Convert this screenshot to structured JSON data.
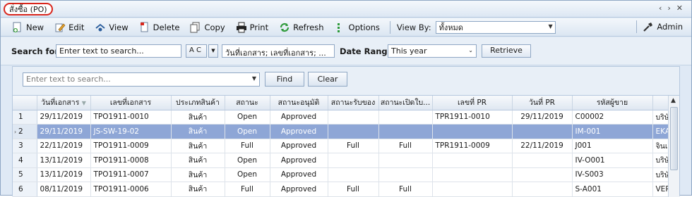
{
  "window": {
    "tab_title": "สั่งซื้อ (PO)",
    "ctrl_prev": "‹",
    "ctrl_next": "›",
    "ctrl_close": "✕"
  },
  "toolbar": {
    "buttons": [
      {
        "label": "New",
        "icon": "new-document-icon",
        "glyph": "📄"
      },
      {
        "label": "Edit",
        "icon": "edit-pencil-icon",
        "glyph": "✎"
      },
      {
        "label": "View",
        "icon": "view-icon",
        "glyph": "⌂"
      },
      {
        "label": "Delete",
        "icon": "delete-icon",
        "glyph": "▮"
      },
      {
        "label": "Copy",
        "icon": "copy-icon",
        "glyph": "❐"
      },
      {
        "label": "Print",
        "icon": "printer-icon",
        "glyph": "⎙"
      },
      {
        "label": "Refresh",
        "icon": "refresh-icon",
        "glyph": "↻"
      },
      {
        "label": "Options",
        "icon": "options-icon",
        "glyph": "⋮"
      }
    ],
    "viewby_label": "View By:",
    "viewby_value": "ทั้งหมด",
    "admin_label": "Admin"
  },
  "search": {
    "label": "Search for",
    "input_value": "Enter text to search...",
    "case_button": "A C",
    "fields_value": "วันที่เอกสาร; เลขที่เอกสาร; ...",
    "date_range_label": "Date Range",
    "date_range_value": "This year",
    "retrieve_label": "Retrieve"
  },
  "filter": {
    "placeholder": "Enter text to search...",
    "find_label": "Find",
    "clear_label": "Clear"
  },
  "grid": {
    "columns": [
      "วันที่เอกสาร",
      "เลขที่เอกสาร",
      "ประเภทสินค้า",
      "สถานะ",
      "สถานะอนุมัติ",
      "สถานะรับของ",
      "สถานะเปิดใบ...",
      "เลขที่ PR",
      "วันที่ PR",
      "รหัสผู้ขาย",
      ""
    ],
    "rows": [
      {
        "n": "1",
        "date": "29/11/2019",
        "doc": "TPO1911-0010",
        "type": "สินค้า",
        "status": "Open",
        "approve": "Approved",
        "receive": "",
        "invoice": "",
        "pr": "TPR1911-0010",
        "prdate": "29/11/2019",
        "vendor": "C00002",
        "extra": "บริษั",
        "selected": false
      },
      {
        "n": "2",
        "date": "29/11/2019",
        "doc": "JS-SW-19-02",
        "type": "สินค้า",
        "status": "Open",
        "approve": "Approved",
        "receive": "",
        "invoice": "",
        "pr": "",
        "prdate": "",
        "vendor": "IM-001",
        "extra": "EKAI",
        "selected": true
      },
      {
        "n": "3",
        "date": "22/11/2019",
        "doc": "TPO1911-0009",
        "type": "สินค้า",
        "status": "Full",
        "approve": "Approved",
        "receive": "Full",
        "invoice": "Full",
        "pr": "TPR1911-0009",
        "prdate": "22/11/2019",
        "vendor": "J001",
        "extra": "จินเ",
        "selected": false
      },
      {
        "n": "4",
        "date": "13/11/2019",
        "doc": "TPO1911-0008",
        "type": "สินค้า",
        "status": "Open",
        "approve": "Approved",
        "receive": "",
        "invoice": "",
        "pr": "",
        "prdate": "",
        "vendor": "IV-O001",
        "extra": "บริษั",
        "selected": false
      },
      {
        "n": "5",
        "date": "13/11/2019",
        "doc": "TPO1911-0007",
        "type": "สินค้า",
        "status": "Open",
        "approve": "Approved",
        "receive": "",
        "invoice": "",
        "pr": "",
        "prdate": "",
        "vendor": "IV-S003",
        "extra": "บริษั",
        "selected": false
      },
      {
        "n": "6",
        "date": "08/11/2019",
        "doc": "TPO1911-0006",
        "type": "สินค้า",
        "status": "Full",
        "approve": "Approved",
        "receive": "Full",
        "invoice": "Full",
        "pr": "",
        "prdate": "",
        "vendor": "S-A001",
        "extra": "VERT",
        "selected": false
      }
    ]
  }
}
